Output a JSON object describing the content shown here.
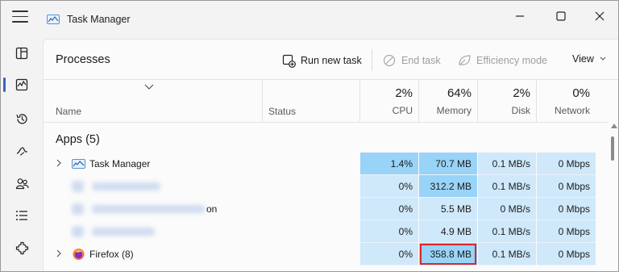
{
  "window": {
    "title": "Task Manager",
    "controls": [
      "minimize-icon",
      "maximize-icon",
      "close-icon"
    ]
  },
  "rail": {
    "items": [
      "processes-icon",
      "performance-icon",
      "app-history-icon",
      "startup-apps-icon",
      "users-icon",
      "details-icon",
      "services-icon"
    ],
    "active": "processes-icon"
  },
  "toolbar": {
    "page_title": "Processes",
    "run_new_task": "Run new task",
    "end_task": "End task",
    "efficiency_mode": "Efficiency mode",
    "view": "View"
  },
  "columns": {
    "name": "Name",
    "status": "Status",
    "cpu": {
      "pct": "2%",
      "label": "CPU"
    },
    "memory": {
      "pct": "64%",
      "label": "Memory"
    },
    "disk": {
      "pct": "2%",
      "label": "Disk"
    },
    "network": {
      "pct": "0%",
      "label": "Network"
    }
  },
  "group": {
    "title": "Apps (5)"
  },
  "rows": [
    {
      "name": "Task Manager",
      "cpu": "1.4%",
      "memory": "70.7 MB",
      "disk": "0.1 MB/s",
      "network": "0 Mbps"
    },
    {
      "name": "",
      "cpu": "0%",
      "memory": "312.2 MB",
      "disk": "0.1 MB/s",
      "network": "0 Mbps"
    },
    {
      "name": "on",
      "cpu": "0%",
      "memory": "5.5 MB",
      "disk": "0 MB/s",
      "network": "0 Mbps"
    },
    {
      "name": "",
      "cpu": "0%",
      "memory": "4.9 MB",
      "disk": "0.1 MB/s",
      "network": "0 Mbps"
    },
    {
      "name": "Firefox (8)",
      "cpu": "0%",
      "memory": "358.8 MB",
      "disk": "0.1 MB/s",
      "network": "0 Mbps"
    }
  ],
  "colors": {
    "heat_dark": "#99d3f7",
    "heat_light": "#cfe9fb",
    "highlight_box": "#d5282e",
    "accent": "#3b62c4"
  }
}
